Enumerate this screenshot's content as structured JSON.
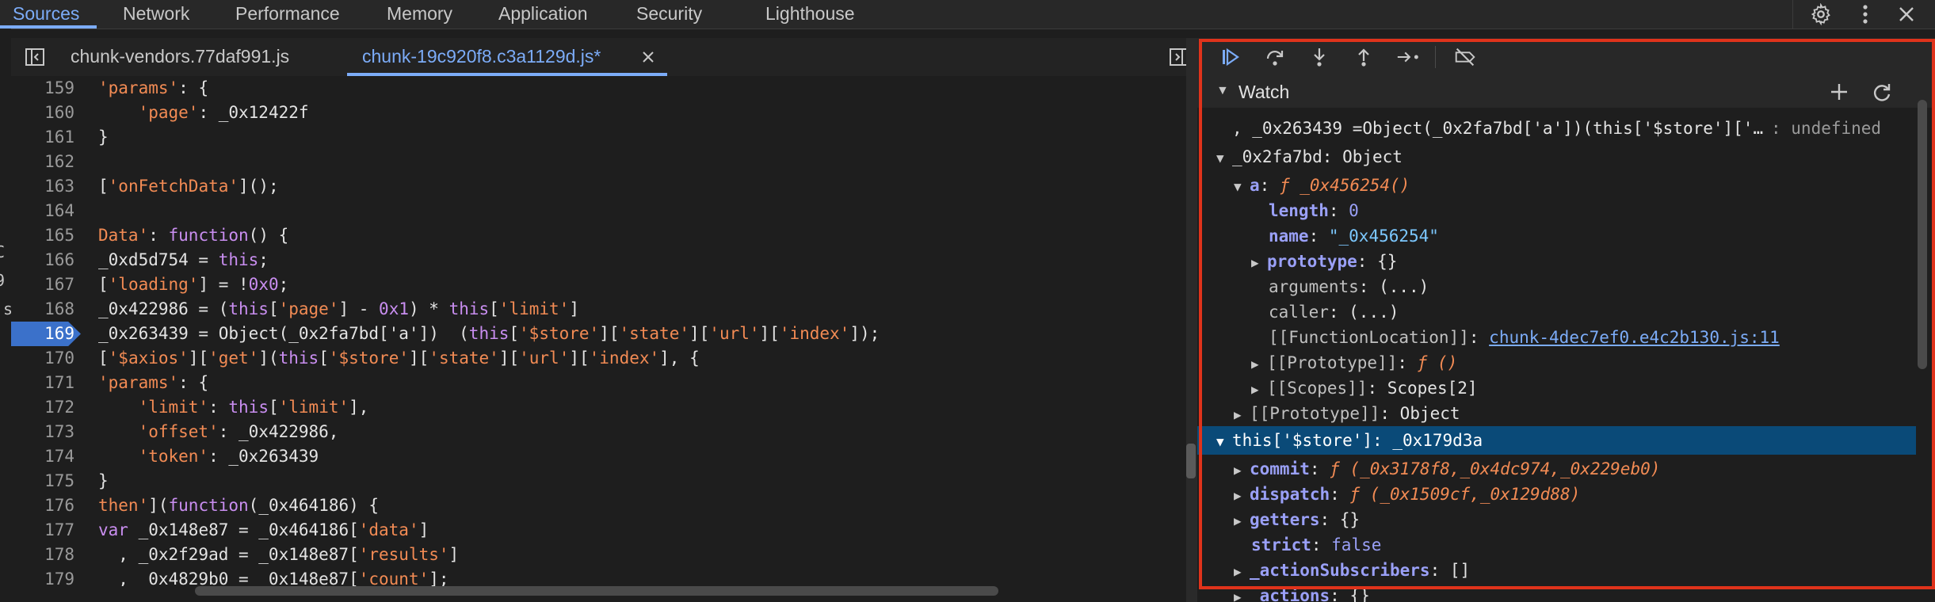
{
  "tabs": [
    {
      "label": "Sources"
    },
    {
      "label": "Network"
    },
    {
      "label": "Performance"
    },
    {
      "label": "Memory"
    },
    {
      "label": "Application"
    },
    {
      "label": "Security"
    },
    {
      "label": "Lighthouse"
    }
  ],
  "file_tabs": [
    {
      "label": "chunk-vendors.77daf991.js"
    },
    {
      "label": "chunk-19c920f8.c3a1129d.js*"
    }
  ],
  "code_lines": [
    {
      "num": "159",
      "parts": [
        [
          "s",
          "'params'"
        ],
        [
          "p",
          ": {"
        ]
      ]
    },
    {
      "num": "160",
      "parts": [
        [
          "p",
          "    "
        ],
        [
          "s",
          "'page'"
        ],
        [
          "p",
          ": _0x12422f"
        ]
      ]
    },
    {
      "num": "161",
      "parts": [
        [
          "p",
          "}"
        ]
      ]
    },
    {
      "num": "162",
      "parts": []
    },
    {
      "num": "163",
      "parts": [
        [
          "p",
          "["
        ],
        [
          "s",
          "'onFetchData'"
        ],
        [
          "p",
          "]();"
        ]
      ]
    },
    {
      "num": "164",
      "parts": []
    },
    {
      "num": "165",
      "parts": [
        [
          "s",
          "Data'"
        ],
        [
          "p",
          ": "
        ],
        [
          "k",
          "function"
        ],
        [
          "p",
          "() {"
        ]
      ]
    },
    {
      "num": "166",
      "parts": [
        [
          "p",
          "_0xd5d754 = "
        ],
        [
          "k",
          "this"
        ],
        [
          "p",
          ";"
        ]
      ]
    },
    {
      "num": "167",
      "parts": [
        [
          "p",
          "["
        ],
        [
          "s",
          "'loading'"
        ],
        [
          "p",
          "] = !"
        ],
        [
          "k",
          "0x0"
        ],
        [
          "p",
          ";"
        ]
      ]
    },
    {
      "num": "168",
      "parts": [
        [
          "p",
          "_0x422986 = ("
        ],
        [
          "k",
          "this"
        ],
        [
          "p",
          "["
        ],
        [
          "s",
          "'page'"
        ],
        [
          "p",
          "] - "
        ],
        [
          "k",
          "0x1"
        ],
        [
          "p",
          ") * "
        ],
        [
          "k",
          "this"
        ],
        [
          "p",
          "["
        ],
        [
          "s",
          "'limit'"
        ],
        [
          "p",
          "]"
        ]
      ]
    },
    {
      "num": "169",
      "parts": [
        [
          "p",
          "_0x263439 = Object(_0x2fa7bd['a'])  ("
        ],
        [
          "k",
          "this"
        ],
        [
          "p",
          "["
        ],
        [
          "s",
          "'$store'"
        ],
        [
          "p",
          "]["
        ],
        [
          "s",
          "'state'"
        ],
        [
          "p",
          "]["
        ],
        [
          "s",
          "'url'"
        ],
        [
          "p",
          "]["
        ],
        [
          "s",
          "'index'"
        ],
        [
          "p",
          "]);"
        ]
      ],
      "breakpoint": true
    },
    {
      "num": "170",
      "parts": [
        [
          "p",
          "["
        ],
        [
          "s",
          "'$axios'"
        ],
        [
          "p",
          "]["
        ],
        [
          "s",
          "'get'"
        ],
        [
          "p",
          "]("
        ],
        [
          "k",
          "this"
        ],
        [
          "p",
          "["
        ],
        [
          "s",
          "'$store'"
        ],
        [
          "p",
          "]["
        ],
        [
          "s",
          "'state'"
        ],
        [
          "p",
          "]["
        ],
        [
          "s",
          "'url'"
        ],
        [
          "p",
          "]["
        ],
        [
          "s",
          "'index'"
        ],
        [
          "p",
          "], {"
        ]
      ]
    },
    {
      "num": "171",
      "parts": [
        [
          "s",
          "'params'"
        ],
        [
          "p",
          ": {"
        ]
      ]
    },
    {
      "num": "172",
      "parts": [
        [
          "p",
          "    "
        ],
        [
          "s",
          "'limit'"
        ],
        [
          "p",
          ": "
        ],
        [
          "k",
          "this"
        ],
        [
          "p",
          "["
        ],
        [
          "s",
          "'limit'"
        ],
        [
          "p",
          "],"
        ]
      ]
    },
    {
      "num": "173",
      "parts": [
        [
          "p",
          "    "
        ],
        [
          "s",
          "'offset'"
        ],
        [
          "p",
          ": _0x422986,"
        ]
      ]
    },
    {
      "num": "174",
      "parts": [
        [
          "p",
          "    "
        ],
        [
          "s",
          "'token'"
        ],
        [
          "p",
          ": _0x263439"
        ]
      ]
    },
    {
      "num": "175",
      "parts": [
        [
          "p",
          "}"
        ]
      ]
    },
    {
      "num": "176",
      "parts": [
        [
          "s",
          "then'"
        ],
        [
          "p",
          "]("
        ],
        [
          "k",
          "function"
        ],
        [
          "p",
          "(_0x464186) {"
        ]
      ]
    },
    {
      "num": "177",
      "parts": [
        [
          "k",
          "var"
        ],
        [
          "p",
          " _0x148e87 = _0x464186["
        ],
        [
          "s",
          "'data'"
        ],
        [
          "p",
          "]"
        ]
      ]
    },
    {
      "num": "178",
      "parts": [
        [
          "p",
          "  , _0x2f29ad = _0x148e87["
        ],
        [
          "s",
          "'results'"
        ],
        [
          "p",
          "]"
        ]
      ]
    },
    {
      "num": "179",
      "parts": [
        [
          "p",
          "  , _0x4829b0 = _0x148e87["
        ],
        [
          "s",
          "'count'"
        ],
        [
          "p",
          "];"
        ]
      ]
    }
  ],
  "left_edge_fragments": [
    "C",
    "9",
    "js"
  ],
  "debugger": {
    "watch_label": "Watch",
    "watch_expr": ", _0x263439 =Object(_0x2fa7bd['a'])(this['$store']['…",
    "watch_expr_value": ": undefined",
    "obj1": {
      "name": "_0x2fa7bd",
      "value": "Object"
    },
    "a_key": "a",
    "a_fn": "ƒ _0x456254()",
    "length_key": "length",
    "length_val": "0",
    "name_key": "name",
    "name_val": "\"_0x456254\"",
    "prototype_key": "prototype",
    "prototype_val": "{}",
    "arguments_key": "arguments",
    "arguments_val": "(...)",
    "caller_key": "caller",
    "caller_val": "(...)",
    "fnloc_key": "[[FunctionLocation]]",
    "fnloc_val": "chunk-4dec7ef0.e4c2b130.js:11",
    "proto1_key": "[[Prototype]]",
    "proto1_val": "ƒ ()",
    "scopes_key": "[[Scopes]]",
    "scopes_val": "Scopes[2]",
    "proto2_key": "[[Prototype]]",
    "proto2_val": "Object",
    "store_key": "this['$store']",
    "store_val": "_0x179d3a",
    "commit_key": "commit",
    "commit_val": "ƒ (_0x3178f8,_0x4dc974,_0x229eb0)",
    "dispatch_key": "dispatch",
    "dispatch_val": "ƒ (_0x1509cf,_0x129d88)",
    "getters_key": "getters",
    "getters_val": "{}",
    "strict_key": "strict",
    "strict_val": "false",
    "actionSubs_key": "_actionSubscribers",
    "actionSubs_val": "[]",
    "actions_key": "_actions",
    "actions_val": "{}"
  },
  "colors": {
    "accent": "#7cacf8",
    "breakpoint": "#3b71ca",
    "highlight_box": "#e0331b",
    "selected_row": "#0a4a78"
  }
}
